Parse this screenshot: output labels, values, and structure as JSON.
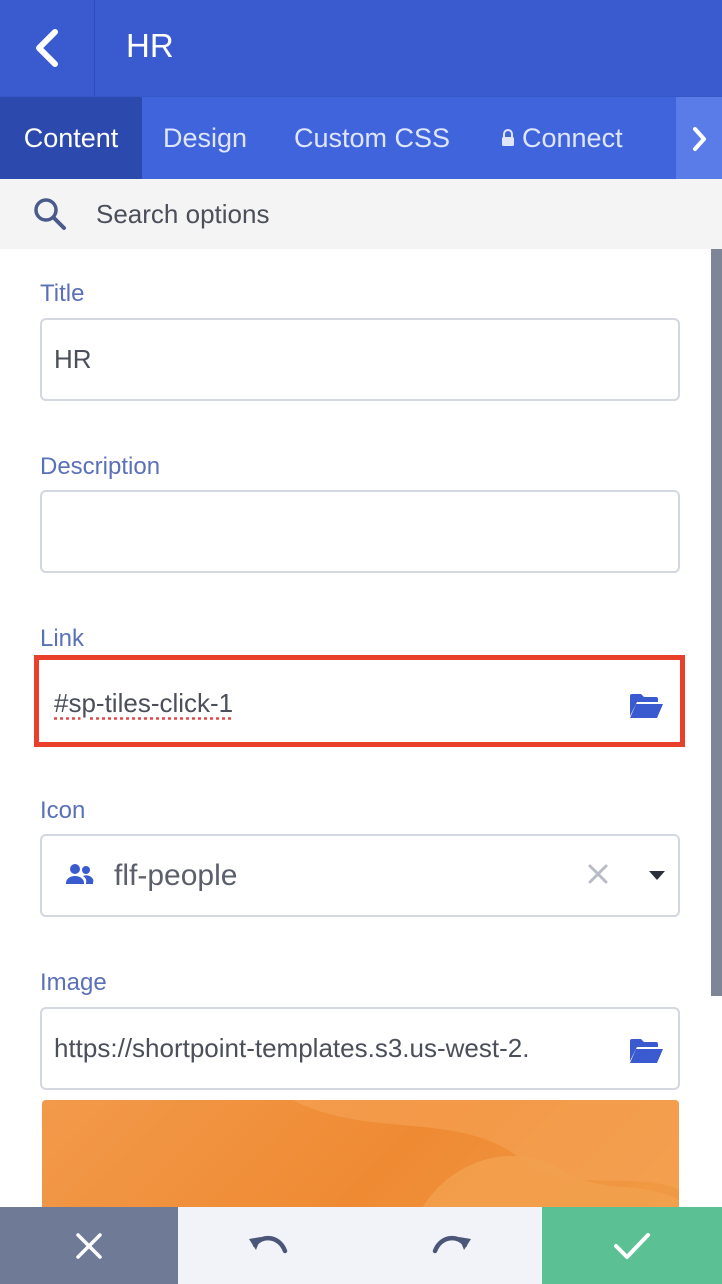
{
  "header": {
    "title": "HR",
    "back_icon": "chevron-left-icon"
  },
  "tabs": [
    {
      "label": "Content",
      "active": true
    },
    {
      "label": "Design",
      "active": false
    },
    {
      "label": "Custom CSS",
      "active": false
    },
    {
      "label": "Connect",
      "active": false,
      "icon": "lock-icon"
    }
  ],
  "search": {
    "placeholder": "Search options",
    "value": ""
  },
  "fields": {
    "title": {
      "label": "Title",
      "value": "HR"
    },
    "description": {
      "label": "Description",
      "value": ""
    },
    "link": {
      "label": "Link",
      "value": "#sp-tiles-click-1",
      "highlighted": true
    },
    "icon": {
      "label": "Icon",
      "value": "flf-people"
    },
    "image": {
      "label": "Image",
      "value": "https://shortpoint-templates.s3.us-west-2."
    }
  },
  "footer": {
    "cancel_icon": "close-icon",
    "undo_icon": "undo-icon",
    "redo_icon": "redo-icon",
    "save_icon": "check-icon"
  },
  "colors": {
    "header": "#3a5bd0",
    "active_tab": "#2c4aad",
    "label": "#5a70b8",
    "highlight": "#e8402a",
    "save": "#5bc195",
    "cancel": "#6e7a96"
  }
}
